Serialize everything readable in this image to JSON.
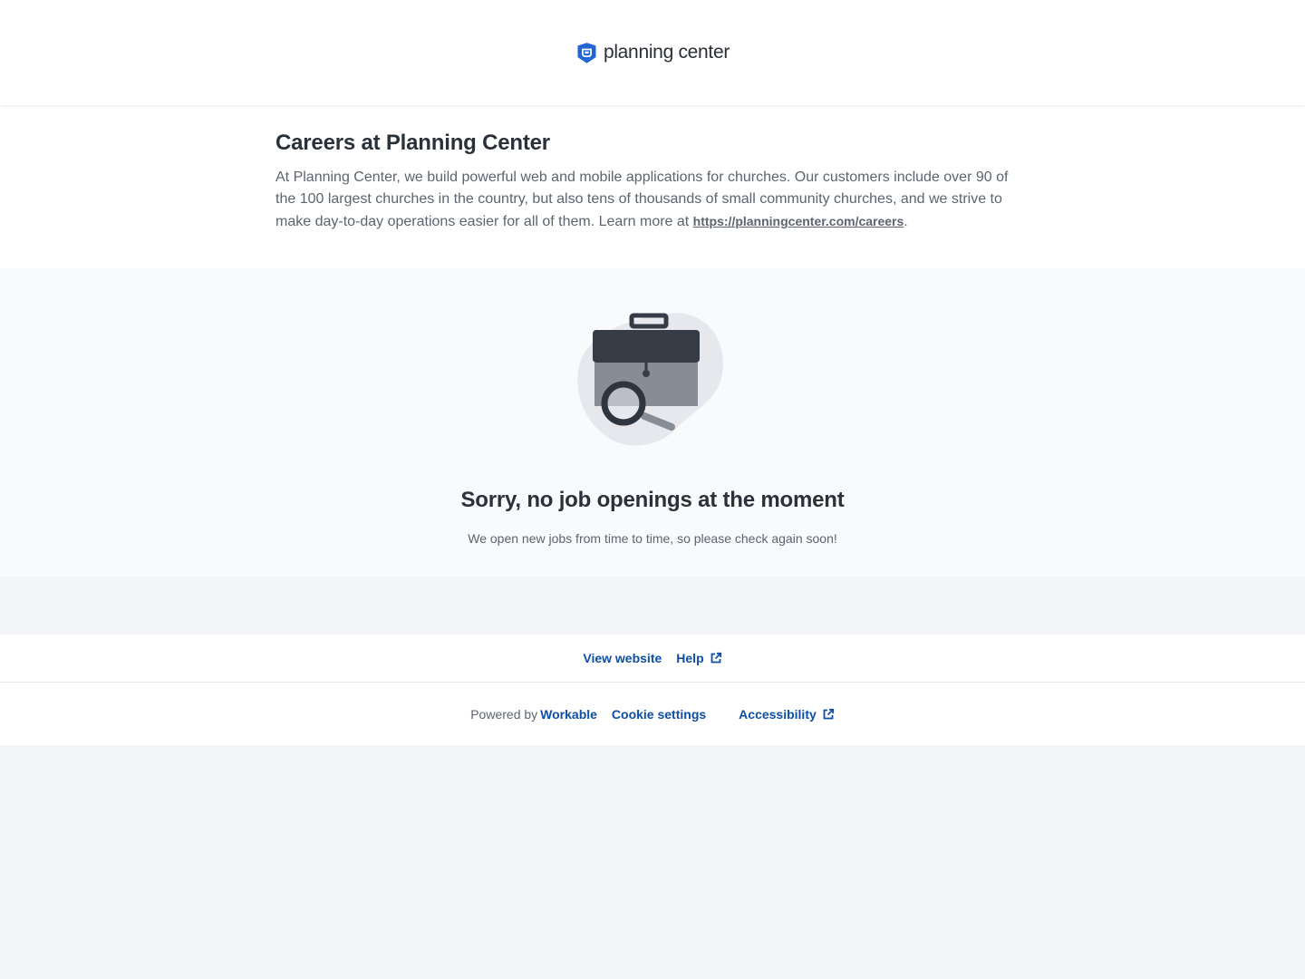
{
  "header": {
    "logo_text": "planning center",
    "brand_color": "#2266d4"
  },
  "intro": {
    "title": "Careers at Planning Center",
    "text": "At Planning Center, we build powerful web and mobile applications for churches. Our customers include over 90 of the 100 largest churches in the country, but also tens of thousands of small community churches, and we strive to make day-to-day operations easier for all of them. Learn more at ",
    "link_text": "https://planningcenter.com/careers",
    "link_suffix": "."
  },
  "empty_state": {
    "icon": "briefcase-search-icon",
    "title": "Sorry, no job openings at the moment",
    "text": "We open new jobs from time to time, so please check again soon!"
  },
  "links": {
    "view_website": "View website",
    "help": "Help"
  },
  "footer": {
    "powered_by": "Powered by",
    "workable": "Workable",
    "cookie_settings": "Cookie settings",
    "accessibility": "Accessibility"
  },
  "colors": {
    "link": "#0d4ea6",
    "text": "#5d646e",
    "heading": "#2b3139"
  }
}
